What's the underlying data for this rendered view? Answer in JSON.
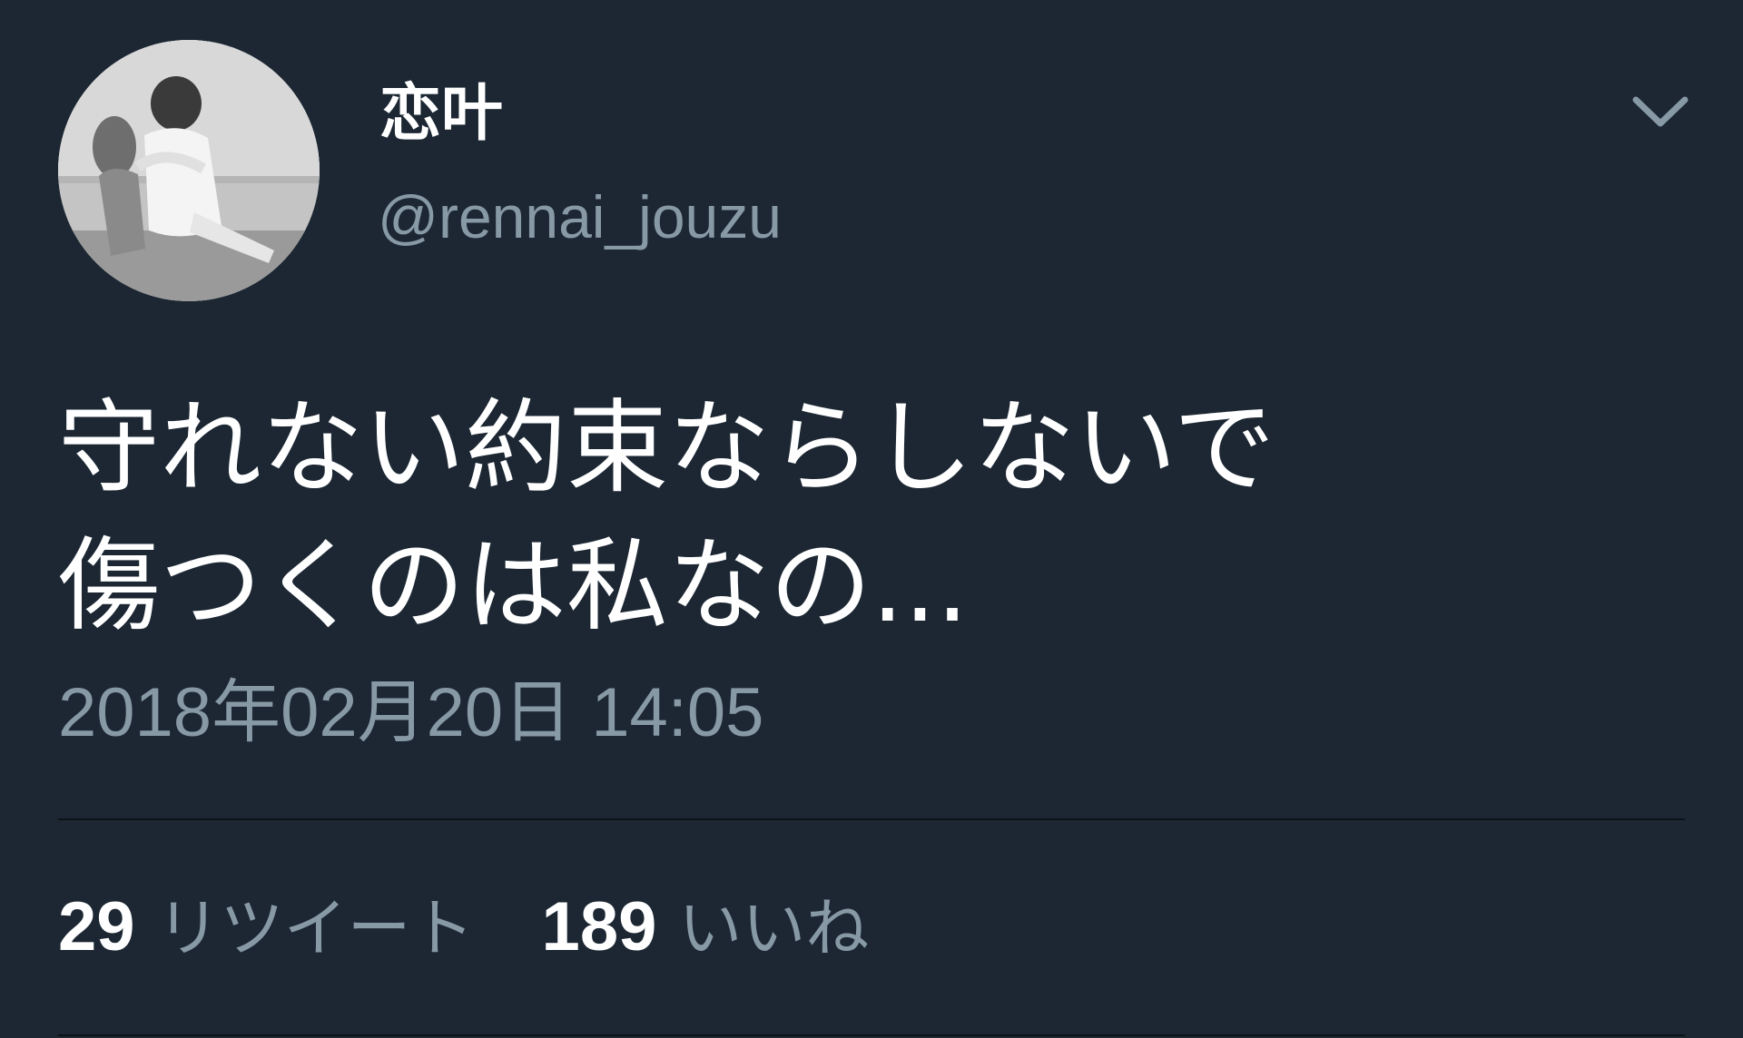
{
  "tweet": {
    "display_name": "恋叶",
    "handle": "@rennai_jouzu",
    "text_line_1": "守れない約束ならしないで",
    "text_line_2": "傷つくのは私なの...",
    "timestamp": "2018年02月20日 14:05",
    "retweets": {
      "count": "29",
      "label": "リツイート"
    },
    "likes": {
      "count": "189",
      "label": "いいね"
    }
  },
  "icons": {
    "caret": "chevron-down-icon",
    "avatar": "profile-photo"
  },
  "colors": {
    "background": "#1c2733",
    "primary_text": "#ffffff",
    "secondary_text": "#8899a6",
    "divider": "#0c1218"
  }
}
